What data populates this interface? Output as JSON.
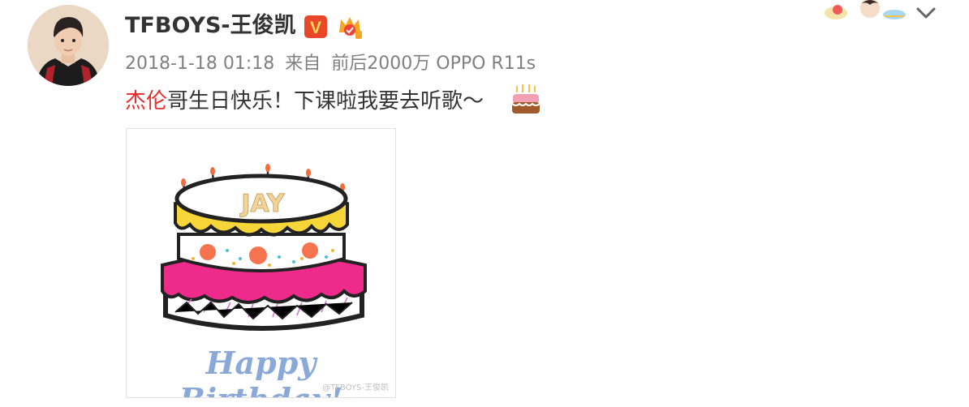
{
  "post": {
    "username": "TFBOYS-王俊凯",
    "verified_badge": "V",
    "timestamp": "2018-1-18 01:18",
    "source_prefix": "来自",
    "source_device": "前后2000万 OPPO R11s",
    "mention": "杰伦",
    "text": "哥生日快乐！下课啦我要去听歌～",
    "emoji": "cake-emoji"
  },
  "image": {
    "cake_name": "JAY",
    "greeting": "Happy Birthday!",
    "watermark": "@TFBOYS-王俊凯"
  },
  "icons": [
    "vip-crown-icon",
    "chevron-down-icon"
  ],
  "colors": {
    "mention": "#eb2a2a",
    "meta_text": "#808080",
    "badge": "#e8472a",
    "greeting": "#8aa9d8"
  }
}
